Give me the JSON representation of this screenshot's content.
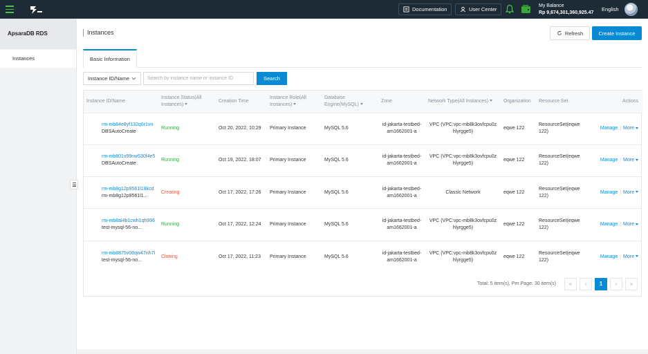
{
  "topbar": {
    "documentation_label": "Documentation",
    "user_center_label": "User Center",
    "balance_label": "My Balance",
    "balance_amount": "Rp 9,674,301,360,925.47",
    "language": "English",
    "accent_color": "#4cc24c"
  },
  "sidebar": {
    "title": "ApsaraDB RDS",
    "items": [
      {
        "label": "Instances"
      }
    ]
  },
  "page": {
    "title": "Instances",
    "refresh_label": "Refresh",
    "create_label": "Create Instance"
  },
  "tabs": [
    {
      "label": "Basic Information"
    }
  ],
  "filter": {
    "selected": "Instance ID/Name",
    "search_placeholder": "Search by instance name or instance ID",
    "search_button": "Search"
  },
  "table": {
    "headers": [
      "Instance ID/Name",
      "Instance Status(All Instances)",
      "Creation Time",
      "Instance Role(All Instances)",
      "Database Engine(MySQL)",
      "Zone",
      "Network Type(All Instances)",
      "Organization",
      "Resource Set",
      "Actions"
    ],
    "rows": [
      {
        "id": "rm-mb84e8yf132q0r1vn",
        "name": "DBSAutoCreate",
        "status": "Running",
        "status_kind": "running",
        "created": "Oct 20, 2022, 10:29",
        "role": "Primary Instance",
        "engine": "MySQL 5.6",
        "zone": "id-jakarta-testbed-am1662001-a",
        "network": "VPC (VPC:vpc-mb8k3ovfcpu0zhlyrgge5)",
        "org": "eqwe 122",
        "resource_set": "ResourceSet(eqwe 122)",
        "manage": "Manage",
        "more": "More"
      },
      {
        "id": "rm-mb801x99nw530f4e5",
        "name": "DBSAutoCreate",
        "status": "Running",
        "status_kind": "running",
        "created": "Oct 19, 2022, 18:07",
        "role": "Primary Instance",
        "engine": "MySQL 5.6",
        "zone": "id-jakarta-testbed-am1662001-a",
        "network": "VPC (VPC:vpc-mb8k3ovfcpu0zhlyrgge5)",
        "org": "eqwe 122",
        "resource_set": "ResourceSet(eqwe 122)",
        "manage": "Manage",
        "more": "More"
      },
      {
        "id": "rm-mb8g12p9561l18kcd",
        "name": "rm-mb8g12p9561l1...",
        "status": "Creating",
        "status_kind": "creating",
        "created": "Oct 17, 2022, 17:26",
        "role": "Primary Instance",
        "engine": "MySQL 5.6",
        "zone": "id-jakarta-testbed-am1662001-a",
        "network": "Classic Network",
        "org": "eqwe 122",
        "resource_set": "ResourceSet(eqwe 122)",
        "manage": "Manage",
        "more": "More"
      },
      {
        "id": "rm-mb8al4b1cwh1qh996",
        "name": "test-mysql-56-no...",
        "status": "Running",
        "status_kind": "running",
        "created": "Oct 17, 2022, 12:24",
        "role": "Primary Instance",
        "engine": "MySQL 5.6",
        "zone": "id-jakarta-testbed-am1662001-a",
        "network": "VPC (VPC:vpc-mb8k3ovfcpu0zhlyrgge5)",
        "org": "eqwe 122",
        "resource_set": "ResourceSet(eqwe 122)",
        "manage": "Manage",
        "more": "More"
      },
      {
        "id": "rm-mb8875v08qw47nh7l",
        "name": "test-mysql-56-no...",
        "status": "Cloning",
        "status_kind": "cloning",
        "created": "Oct 17, 2022, 11:23",
        "role": "Primary Instance",
        "engine": "MySQL 5.6",
        "zone": "id-jakarta-testbed-am1662001-a",
        "network": "VPC (VPC:vpc-mb8k3ovfcpu0zhlyrgge5)",
        "org": "eqwe 122",
        "resource_set": "ResourceSet(eqwe 122)",
        "manage": "Manage",
        "more": "More"
      }
    ]
  },
  "pagination": {
    "info": "Total: 5 item(s),   Per Page: 30 item(s)",
    "current_page": "1",
    "first": "«",
    "prev": "‹",
    "next": "›",
    "last": "»"
  }
}
